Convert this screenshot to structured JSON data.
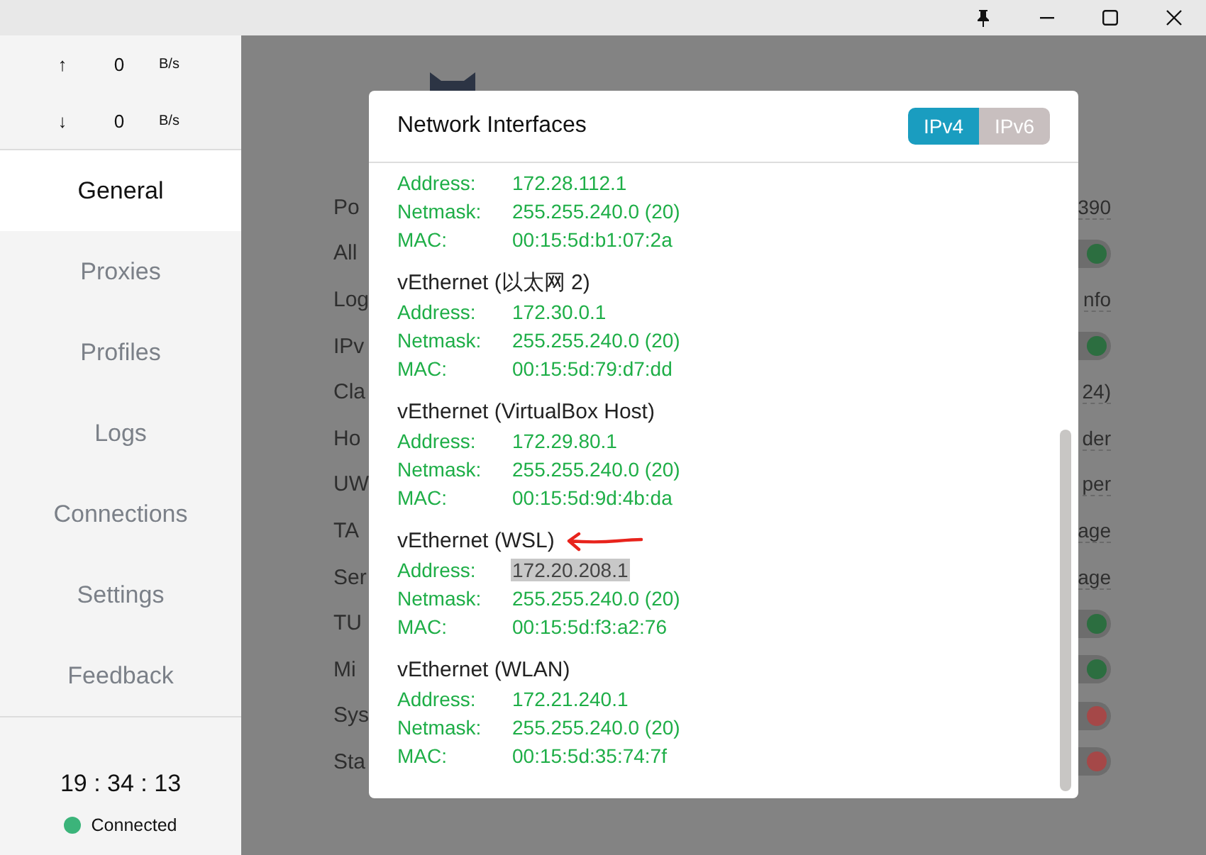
{
  "window_controls": [
    {
      "kind": "pin"
    },
    {
      "kind": "minimize"
    },
    {
      "kind": "maximize"
    },
    {
      "kind": "close"
    }
  ],
  "sidebar": {
    "traffic": [
      {
        "arrow": "↑",
        "value": "0",
        "unit": "B/s"
      },
      {
        "arrow": "↓",
        "value": "0",
        "unit": "B/s"
      }
    ],
    "items": [
      {
        "label": "General",
        "selected": true
      },
      {
        "label": "Proxies",
        "selected": false
      },
      {
        "label": "Profiles",
        "selected": false
      },
      {
        "label": "Logs",
        "selected": false
      },
      {
        "label": "Connections",
        "selected": false
      },
      {
        "label": "Settings",
        "selected": false
      },
      {
        "label": "Feedback",
        "selected": false
      }
    ],
    "clock": "19 : 34 : 13",
    "status": {
      "label": "Connected",
      "color": "#3bb47a"
    }
  },
  "settings_rows": [
    {
      "label": "Po",
      "kind": "text",
      "value": "390"
    },
    {
      "label": "All",
      "kind": "toggle",
      "on": true
    },
    {
      "label": "Log",
      "kind": "text",
      "value": "nfo"
    },
    {
      "label": "IPv",
      "kind": "toggle",
      "on": true
    },
    {
      "label": "Cla",
      "kind": "text",
      "value": "24)"
    },
    {
      "label": "Ho",
      "kind": "text",
      "value": "der"
    },
    {
      "label": "UW",
      "kind": "text",
      "value": "per"
    },
    {
      "label": "TA",
      "kind": "text",
      "value": "age"
    },
    {
      "label": "Ser",
      "kind": "text",
      "value": "age"
    },
    {
      "label": "TU",
      "kind": "toggle",
      "on": true
    },
    {
      "label": "Mi",
      "kind": "toggle",
      "on": true
    },
    {
      "label": "Sys",
      "kind": "toggle",
      "on": false
    },
    {
      "label": "Sta",
      "kind": "toggle",
      "on": false
    }
  ],
  "modal": {
    "title": "Network Interfaces",
    "tabs": [
      {
        "label": "IPv4",
        "selected": true
      },
      {
        "label": "IPv6",
        "selected": false
      }
    ],
    "interfaces": [
      {
        "marked": false,
        "fields": [
          {
            "label": "Address:",
            "value": "172.28.112.1",
            "highlighted": false
          },
          {
            "label": "Netmask:",
            "value": "255.255.240.0 (20)",
            "highlighted": false
          },
          {
            "label": "MAC:",
            "value": "00:15:5d:b1:07:2a",
            "highlighted": false
          }
        ]
      },
      {
        "name": "vEthernet (以太网 2)",
        "marked": false,
        "fields": [
          {
            "label": "Address:",
            "value": "172.30.0.1",
            "highlighted": false
          },
          {
            "label": "Netmask:",
            "value": "255.255.240.0 (20)",
            "highlighted": false
          },
          {
            "label": "MAC:",
            "value": "00:15:5d:79:d7:dd",
            "highlighted": false
          }
        ]
      },
      {
        "name": "vEthernet (VirtualBox Host)",
        "marked": false,
        "fields": [
          {
            "label": "Address:",
            "value": "172.29.80.1",
            "highlighted": false
          },
          {
            "label": "Netmask:",
            "value": "255.255.240.0 (20)",
            "highlighted": false
          },
          {
            "label": "MAC:",
            "value": "00:15:5d:9d:4b:da",
            "highlighted": false
          }
        ]
      },
      {
        "name": "vEthernet (WSL)",
        "marked": true,
        "fields": [
          {
            "label": "Address:",
            "value": "172.20.208.1",
            "highlighted": true
          },
          {
            "label": "Netmask:",
            "value": "255.255.240.0 (20)",
            "highlighted": false
          },
          {
            "label": "MAC:",
            "value": "00:15:5d:f3:a2:76",
            "highlighted": false
          }
        ]
      },
      {
        "name": "vEthernet (WLAN)",
        "marked": false,
        "fields": [
          {
            "label": "Address:",
            "value": "172.21.240.1",
            "highlighted": false
          },
          {
            "label": "Netmask:",
            "value": "255.255.240.0 (20)",
            "highlighted": false
          },
          {
            "label": "MAC:",
            "value": "00:15:5d:35:74:7f",
            "highlighted": false
          }
        ]
      }
    ]
  }
}
